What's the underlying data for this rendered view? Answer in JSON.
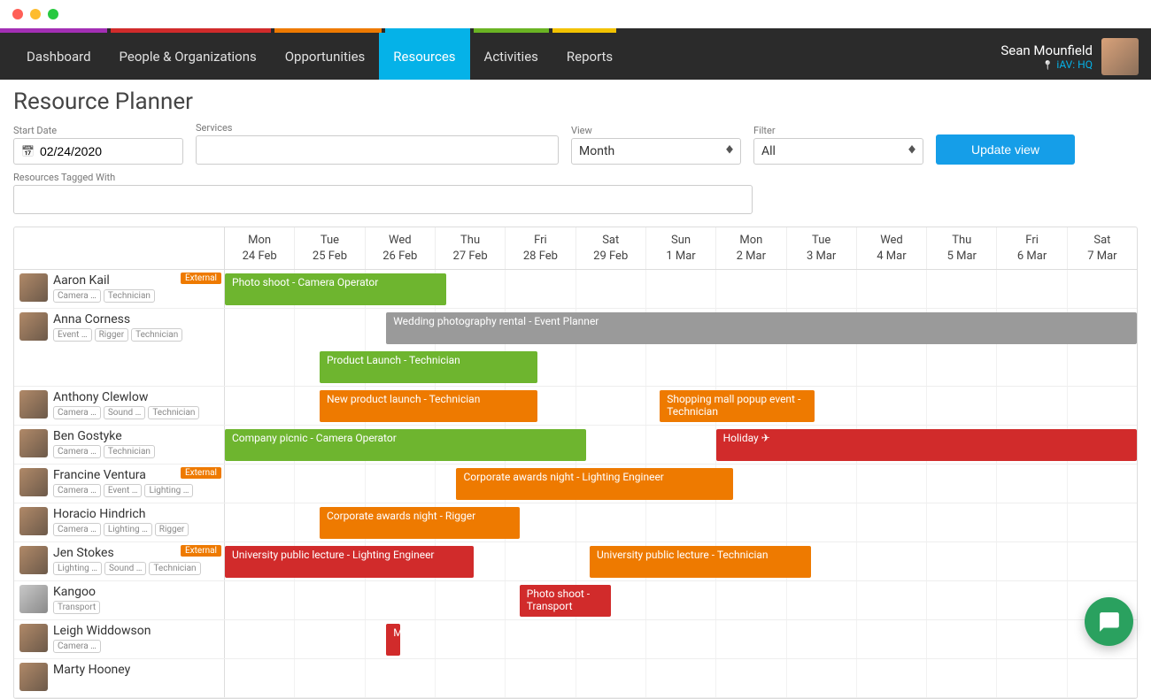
{
  "nav": {
    "items": [
      "Dashboard",
      "People & Organizations",
      "Opportunities",
      "Resources",
      "Activities",
      "Reports"
    ],
    "activeIndex": 3
  },
  "user": {
    "name": "Sean Mounfield",
    "location": "iAV: HQ"
  },
  "pageTitle": "Resource Planner",
  "filters": {
    "startDateLabel": "Start Date",
    "startDate": "02/24/2020",
    "servicesLabel": "Services",
    "services": "",
    "viewLabel": "View",
    "view": "Month",
    "filterLabel": "Filter",
    "filter": "All",
    "updateBtn": "Update view",
    "tagsLabel": "Resources Tagged With",
    "tags": ""
  },
  "days": [
    {
      "dow": "Mon",
      "date": "24 Feb"
    },
    {
      "dow": "Tue",
      "date": "25 Feb"
    },
    {
      "dow": "Wed",
      "date": "26 Feb"
    },
    {
      "dow": "Thu",
      "date": "27 Feb"
    },
    {
      "dow": "Fri",
      "date": "28 Feb"
    },
    {
      "dow": "Sat",
      "date": "29 Feb"
    },
    {
      "dow": "Sun",
      "date": "1 Mar"
    },
    {
      "dow": "Mon",
      "date": "2 Mar"
    },
    {
      "dow": "Tue",
      "date": "3 Mar"
    },
    {
      "dow": "Wed",
      "date": "4 Mar"
    },
    {
      "dow": "Thu",
      "date": "5 Mar"
    },
    {
      "dow": "Fri",
      "date": "6 Mar"
    },
    {
      "dow": "Sat",
      "date": "7 Mar"
    }
  ],
  "externalLabel": "External",
  "resources": [
    {
      "name": "Aaron Kail",
      "tags": [
        "Camera …",
        "Technician"
      ],
      "external": true,
      "avatar": "person",
      "events": [
        {
          "label": "Photo shoot - Camera Operator",
          "color": "green",
          "start": 0,
          "end": 3.15
        }
      ]
    },
    {
      "name": "Anna Corness",
      "tags": [
        "Event …",
        "Rigger",
        "Technician"
      ],
      "external": false,
      "avatar": "person",
      "events": [
        {
          "label": "Wedding photography rental - Event Planner",
          "color": "grey",
          "start": 2.3,
          "end": 13,
          "row": 0
        },
        {
          "label": "Product Launch - Technician",
          "color": "green",
          "start": 1.35,
          "end": 4.45,
          "row": 1
        }
      ]
    },
    {
      "name": "Anthony Clewlow",
      "tags": [
        "Camera …",
        "Sound …",
        "Technician"
      ],
      "external": false,
      "avatar": "person",
      "events": [
        {
          "label": "New product launch - Technician",
          "color": "orange",
          "start": 1.35,
          "end": 4.45
        },
        {
          "label": "Shopping mall popup event - Technician",
          "color": "orange",
          "start": 6.2,
          "end": 8.4,
          "twoLine": true
        }
      ]
    },
    {
      "name": "Ben Gostyke",
      "tags": [
        "Camera …",
        "Technician"
      ],
      "external": false,
      "avatar": "person",
      "events": [
        {
          "label": "Company picnic - Camera Operator",
          "color": "green",
          "start": 0,
          "end": 5.15
        },
        {
          "label": "Holiday ✈",
          "color": "red",
          "start": 7,
          "end": 13
        }
      ]
    },
    {
      "name": "Francine Ventura",
      "tags": [
        "Camera …",
        "Event …",
        "Lighting …"
      ],
      "external": true,
      "avatar": "person",
      "events": [
        {
          "label": "Corporate awards night - Lighting Engineer",
          "color": "orange",
          "start": 3.3,
          "end": 7.25
        }
      ]
    },
    {
      "name": "Horacio Hindrich",
      "tags": [
        "Camera …",
        "Lighting …",
        "Rigger"
      ],
      "external": false,
      "avatar": "person",
      "events": [
        {
          "label": "Corporate awards night - Rigger",
          "color": "orange",
          "start": 1.35,
          "end": 4.2
        }
      ]
    },
    {
      "name": "Jen Stokes",
      "tags": [
        "Lighting …",
        "Sound …",
        "Technician"
      ],
      "external": true,
      "avatar": "person",
      "events": [
        {
          "label": "University public lecture - Lighting Engineer",
          "color": "red",
          "start": 0,
          "end": 3.55
        },
        {
          "label": "University public lecture - Technician",
          "color": "orange",
          "start": 5.2,
          "end": 8.35
        }
      ]
    },
    {
      "name": "Kangoo",
      "tags": [
        "Transport"
      ],
      "external": false,
      "avatar": "van",
      "events": [
        {
          "label": "Photo shoot - Transport",
          "color": "red",
          "start": 4.2,
          "end": 5.5,
          "twoLine": true
        }
      ]
    },
    {
      "name": "Leigh Widdowson",
      "tags": [
        "Camera …"
      ],
      "external": false,
      "avatar": "person",
      "events": [
        {
          "label": "M",
          "color": "red",
          "start": 2.3,
          "end": 2.5
        }
      ]
    },
    {
      "name": "Marty Hooney",
      "tags": [],
      "external": false,
      "avatar": "person",
      "events": []
    }
  ]
}
